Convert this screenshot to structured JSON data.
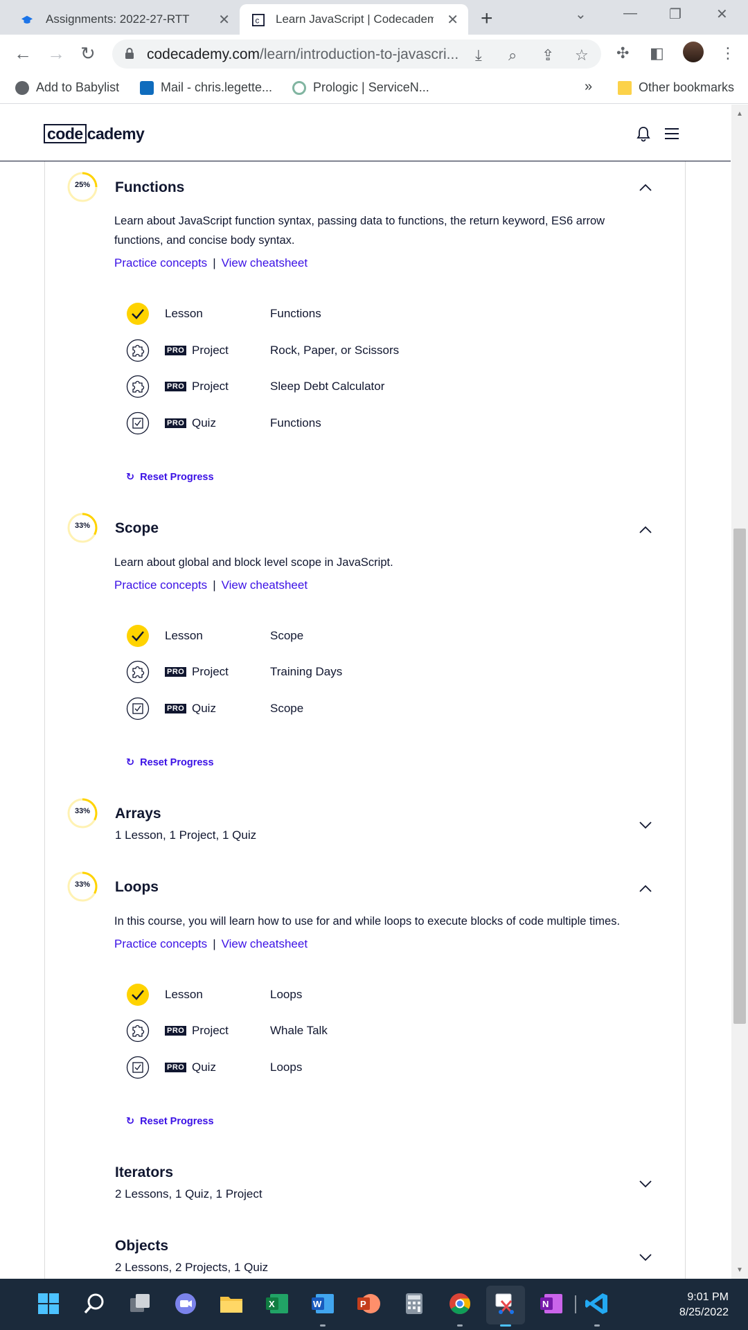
{
  "browser": {
    "tabs": [
      {
        "title": "Assignments: 2022-27-RTT"
      },
      {
        "title": "Learn JavaScript | Codecadem"
      }
    ],
    "url_main": "codecademy.com",
    "url_path": "/learn/introduction-to-javascri...",
    "bookmarks": [
      "Add to Babylist",
      "Mail - chris.legette...",
      "Prologic | ServiceN..."
    ],
    "bookmarks_more": "»",
    "other_bookmarks": "Other bookmarks"
  },
  "site": {
    "logo_box": "code",
    "logo_rest": "cademy"
  },
  "links": {
    "practice": "Practice concepts",
    "sep": "|",
    "cheatsheet": "View cheatsheet",
    "reset": "Reset Progress"
  },
  "pro_label": "PRO",
  "modules": {
    "functions": {
      "progress": "25%",
      "progress_value": 0.25,
      "title": "Functions",
      "description": "Learn about JavaScript function syntax, passing data to functions, the return keyword, ES6 arrow functions, and concise body syntax.",
      "items": [
        {
          "kind": "Lesson",
          "name": "Functions",
          "pro": false,
          "done": true
        },
        {
          "kind": "Project",
          "name": "Rock, Paper, or Scissors",
          "pro": true
        },
        {
          "kind": "Project",
          "name": "Sleep Debt Calculator",
          "pro": true
        },
        {
          "kind": "Quiz",
          "name": "Functions",
          "pro": true
        }
      ]
    },
    "scope": {
      "progress": "33%",
      "progress_value": 0.33,
      "title": "Scope",
      "description": "Learn about global and block level scope in JavaScript.",
      "items": [
        {
          "kind": "Lesson",
          "name": "Scope",
          "pro": false,
          "done": true
        },
        {
          "kind": "Project",
          "name": "Training Days",
          "pro": true
        },
        {
          "kind": "Quiz",
          "name": "Scope",
          "pro": true
        }
      ]
    },
    "arrays": {
      "progress": "33%",
      "progress_value": 0.33,
      "title": "Arrays",
      "summary": "1 Lesson, 1 Project, 1 Quiz"
    },
    "loops": {
      "progress": "33%",
      "progress_value": 0.33,
      "title": "Loops",
      "description": "In this course, you will learn how to use for and while loops to execute blocks of code multiple times.",
      "items": [
        {
          "kind": "Lesson",
          "name": "Loops",
          "pro": false,
          "done": true
        },
        {
          "kind": "Project",
          "name": "Whale Talk",
          "pro": true
        },
        {
          "kind": "Quiz",
          "name": "Loops",
          "pro": true
        }
      ]
    },
    "iterators": {
      "title": "Iterators",
      "summary": "2 Lessons, 1 Quiz, 1 Project"
    },
    "objects": {
      "title": "Objects",
      "summary": "2 Lessons, 2 Projects, 1 Quiz"
    }
  },
  "taskbar": {
    "time": "9:01 PM",
    "date": "8/25/2022"
  },
  "colors": {
    "accent": "#3a10e5",
    "progress": "#ffd300",
    "navy": "#10162f"
  }
}
